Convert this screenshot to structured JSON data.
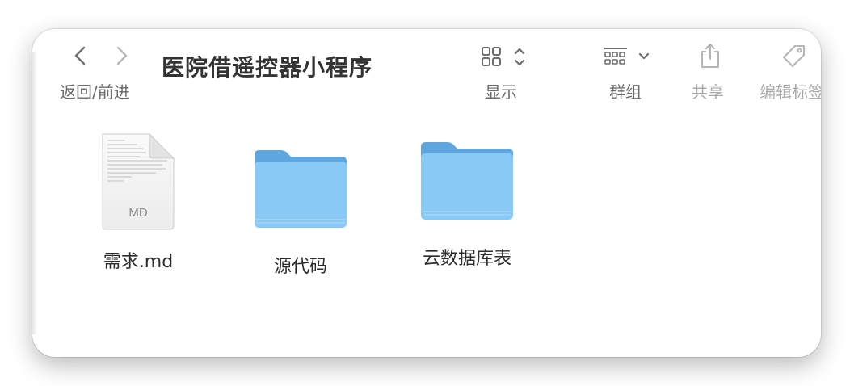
{
  "window": {
    "title": "医院借遥控器小程序"
  },
  "toolbar": {
    "nav_label": "返回/前进",
    "view_label": "显示",
    "group_label": "群组",
    "share_label": "共享",
    "tags_label": "编辑标签"
  },
  "files": [
    {
      "name": "需求.md",
      "kind": "document",
      "badge": "MD"
    },
    {
      "name": "源代码",
      "kind": "folder"
    },
    {
      "name": "云数据库表",
      "kind": "folder"
    }
  ],
  "colors": {
    "folder_front": "#88c9f5",
    "folder_back": "#5fa5de",
    "toolbar_icon": "#6e6e6e",
    "disabled_icon": "#b5b5b5"
  }
}
